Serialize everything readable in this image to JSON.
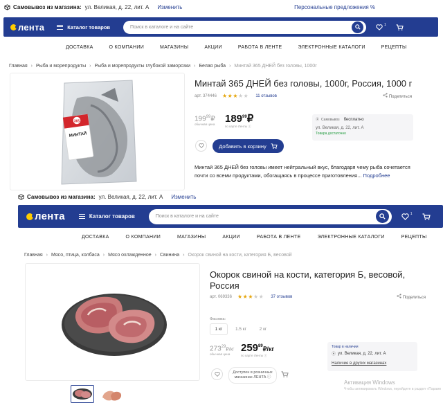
{
  "s1": {
    "topbar": {
      "label": "Самовывоз из магазина:",
      "address": "ул. Великая, д. 22, лит. А",
      "change": "Изменить",
      "offers": "Персональные предложения %"
    },
    "logo": "лента",
    "catalog": "Каталог товаров",
    "search_placeholder": "Поиск в каталоге и на сайте",
    "fav_count": "1",
    "nav": [
      "ДОСТАВКА",
      "О КОМПАНИИ",
      "МАГАЗИНЫ",
      "АКЦИИ",
      "РАБОТА В ЛЕНТЕ",
      "ЭЛЕКТРОННЫЕ КАТАЛОГИ",
      "РЕЦЕПТЫ"
    ],
    "crumbs": [
      "Главная",
      "Рыба и морепродукты",
      "Рыба и морепродукты глубокой заморозки",
      "Белая рыба",
      "Минтай 365 ДНЕЙ без головы, 1000г"
    ],
    "product": {
      "title": "Минтай 365 ДНЕЙ без головы, 1000г, Россия, 1000 г",
      "article": "арт. 374446",
      "rating": 3.5,
      "reviews": "11 отзывов",
      "share": "Поделиться",
      "old_price_int": "199",
      "old_price_frac": "99",
      "old_price_cur": "₽",
      "old_caption": "обычная цена",
      "price_int": "189",
      "price_frac": "99",
      "price_cur": "₽",
      "price_caption": "по карте Ленты ⓘ",
      "pickup_label": "Самовывоз",
      "pickup_value": "бесплатно",
      "pickup_address": "ул. Великая, д. 22, лит. А",
      "stock": "Товара достаточно",
      "add_to_cart": "Добавить в корзину",
      "description": "Минтай 365 ДНЕЙ без головы имеет нейтральный вкус, благодаря чему рыба сочетается почти со всеми продуктами, обогащаясь в процессе приготовления...",
      "more": "Подробнее",
      "pack_brand": "МИНТАЙ",
      "pack_badge": "365"
    }
  },
  "s2": {
    "topbar": {
      "label": "Самовывоз из магазина:",
      "address": "ул. Великая, д. 22, лит. А",
      "change": "Изменить"
    },
    "logo": "лента",
    "catalog": "Каталог товаров",
    "search_placeholder": "Поиск в каталоге и на сайте",
    "fav_count": "1",
    "nav": [
      "ДОСТАВКА",
      "О КОМПАНИИ",
      "МАГАЗИНЫ",
      "АКЦИИ",
      "РАБОТА В ЛЕНТЕ",
      "ЭЛЕКТРОННЫЕ КАТАЛОГИ",
      "РЕЦЕПТЫ"
    ],
    "crumbs": [
      "Главная",
      "Мясо, птица, колбаса",
      "Мясо охлажденное",
      "Свинина",
      "Окорок свиной на кости, категория Б, весовой"
    ],
    "product": {
      "title": "Окорок свиной на кости, категория Б, весовой, Россия",
      "article": "арт. 069336",
      "rating": 3.5,
      "reviews": "37 отзывов",
      "share": "Поделиться",
      "pack_label": "Фасовка:",
      "packs": [
        "1 кг",
        "1.5 кг",
        "2 кг"
      ],
      "old_price_int": "273",
      "old_price_frac": "29",
      "old_price_cur": "₽/кг",
      "old_caption": "обычная цена",
      "price_int": "259",
      "price_frac": "89",
      "price_cur": "₽/кг",
      "price_caption": "по карте Ленты ⓘ",
      "stock_label": "Товар в наличии",
      "pickup_address": "ул. Великая, д. 22, лит. А",
      "other_stores": "Наличие в других магазинах",
      "retail_line1": "Доступен в розничных",
      "retail_line2": "магазинах ЛЕНТА"
    }
  },
  "watermark": {
    "line1": "Активация Windows",
    "line2": "Чтобы активировать Windows, перейдите в раздел «Параметры»."
  },
  "colors": {
    "brand": "#233d91",
    "accent": "#ffcc00",
    "stars": "#e5a50a",
    "in_stock": "#1f9a3c"
  }
}
